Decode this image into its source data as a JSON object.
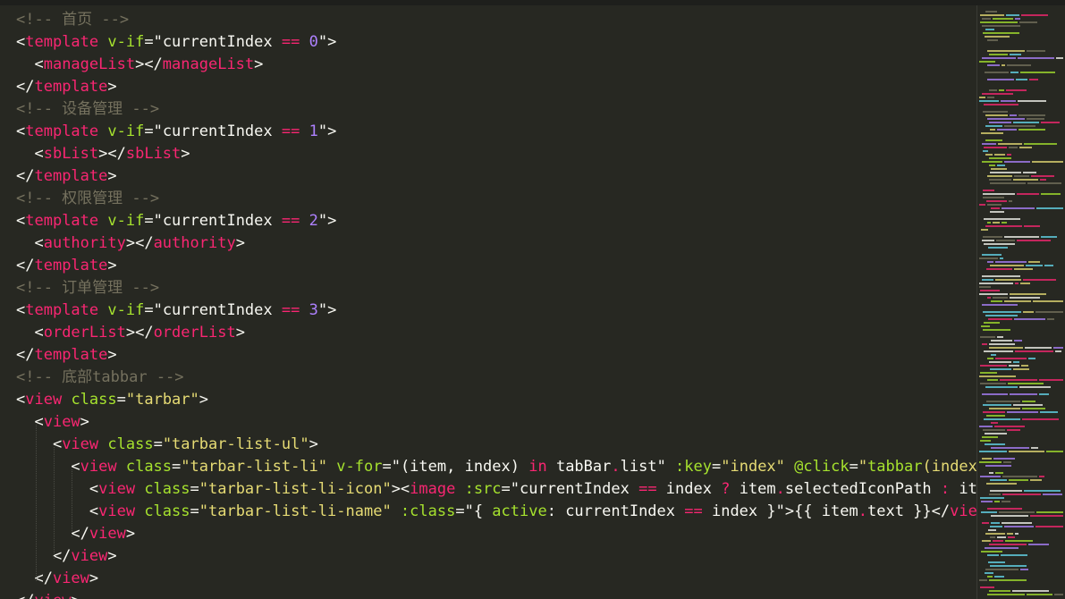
{
  "lines": [
    [
      [
        "c",
        "<!-- 首页 -->"
      ]
    ],
    [
      [
        "p",
        "<"
      ],
      [
        "t",
        "template"
      ],
      [
        "a",
        " v-if"
      ],
      [
        "p",
        "=\""
      ],
      [
        "p",
        "currentIndex "
      ],
      [
        "o",
        "=="
      ],
      [
        "p",
        " "
      ],
      [
        "n",
        "0"
      ],
      [
        "p",
        "\">"
      ]
    ],
    [
      [
        "p",
        "  <"
      ],
      [
        "t",
        "manageList"
      ],
      [
        "p",
        "></"
      ],
      [
        "t",
        "manageList"
      ],
      [
        "p",
        ">"
      ]
    ],
    [
      [
        "p",
        "</"
      ],
      [
        "t",
        "template"
      ],
      [
        "p",
        ">"
      ]
    ],
    [
      [
        "c",
        "<!-- 设备管理 -->"
      ]
    ],
    [
      [
        "p",
        "<"
      ],
      [
        "t",
        "template"
      ],
      [
        "a",
        " v-if"
      ],
      [
        "p",
        "=\""
      ],
      [
        "p",
        "currentIndex "
      ],
      [
        "o",
        "=="
      ],
      [
        "p",
        " "
      ],
      [
        "n",
        "1"
      ],
      [
        "p",
        "\">"
      ]
    ],
    [
      [
        "p",
        "  <"
      ],
      [
        "t",
        "sbList"
      ],
      [
        "p",
        "></"
      ],
      [
        "t",
        "sbList"
      ],
      [
        "p",
        ">"
      ]
    ],
    [
      [
        "p",
        "</"
      ],
      [
        "t",
        "template"
      ],
      [
        "p",
        ">"
      ]
    ],
    [
      [
        "c",
        "<!-- 权限管理 -->"
      ]
    ],
    [
      [
        "p",
        "<"
      ],
      [
        "t",
        "template"
      ],
      [
        "a",
        " v-if"
      ],
      [
        "p",
        "=\""
      ],
      [
        "p",
        "currentIndex "
      ],
      [
        "o",
        "=="
      ],
      [
        "p",
        " "
      ],
      [
        "n",
        "2"
      ],
      [
        "p",
        "\">"
      ]
    ],
    [
      [
        "p",
        "  <"
      ],
      [
        "t",
        "authority"
      ],
      [
        "p",
        "></"
      ],
      [
        "t",
        "authority"
      ],
      [
        "p",
        ">"
      ]
    ],
    [
      [
        "p",
        "</"
      ],
      [
        "t",
        "template"
      ],
      [
        "p",
        ">"
      ]
    ],
    [
      [
        "c",
        "<!-- 订单管理 -->"
      ]
    ],
    [
      [
        "p",
        "<"
      ],
      [
        "t",
        "template"
      ],
      [
        "a",
        " v-if"
      ],
      [
        "p",
        "=\""
      ],
      [
        "p",
        "currentIndex "
      ],
      [
        "o",
        "=="
      ],
      [
        "p",
        " "
      ],
      [
        "n",
        "3"
      ],
      [
        "p",
        "\">"
      ]
    ],
    [
      [
        "p",
        "  <"
      ],
      [
        "t",
        "orderList"
      ],
      [
        "p",
        "></"
      ],
      [
        "t",
        "orderList"
      ],
      [
        "p",
        ">"
      ]
    ],
    [
      [
        "p",
        "</"
      ],
      [
        "t",
        "template"
      ],
      [
        "p",
        ">"
      ]
    ],
    [
      [
        "c",
        "<!-- 底部tabbar -->"
      ]
    ],
    [
      [
        "p",
        "<"
      ],
      [
        "t",
        "view"
      ],
      [
        "a",
        " class"
      ],
      [
        "p",
        "="
      ],
      [
        "s",
        "\"tarbar\""
      ],
      [
        "p",
        ">"
      ]
    ],
    [
      [
        "p",
        "  <"
      ],
      [
        "t",
        "view"
      ],
      [
        "p",
        ">"
      ]
    ],
    [
      [
        "p",
        "    <"
      ],
      [
        "t",
        "view"
      ],
      [
        "a",
        " class"
      ],
      [
        "p",
        "="
      ],
      [
        "s",
        "\"tarbar-list-ul\""
      ],
      [
        "p",
        ">"
      ]
    ],
    [
      [
        "p",
        "      <"
      ],
      [
        "t",
        "view"
      ],
      [
        "a",
        " class"
      ],
      [
        "p",
        "="
      ],
      [
        "s",
        "\"tarbar-list-li\""
      ],
      [
        "a",
        " v-for"
      ],
      [
        "p",
        "=\"(item, index) "
      ],
      [
        "o",
        "in"
      ],
      [
        "p",
        " tabBar"
      ],
      [
        "o",
        "."
      ],
      [
        "p",
        "list\""
      ],
      [
        "a",
        " :key"
      ],
      [
        "p",
        "="
      ],
      [
        "s",
        "\"index\""
      ],
      [
        "a",
        " @click"
      ],
      [
        "p",
        "="
      ],
      [
        "s",
        "\""
      ],
      [
        "a",
        "tabbar"
      ],
      [
        "s",
        "(index)\""
      ],
      [
        "p",
        ">"
      ]
    ],
    [
      [
        "p",
        "        <"
      ],
      [
        "t",
        "view"
      ],
      [
        "a",
        " class"
      ],
      [
        "p",
        "="
      ],
      [
        "s",
        "\"tarbar-list-li-icon\""
      ],
      [
        "p",
        "><"
      ],
      [
        "t",
        "image"
      ],
      [
        "a",
        " :src"
      ],
      [
        "p",
        "=\"currentIndex "
      ],
      [
        "o",
        "=="
      ],
      [
        "p",
        " index "
      ],
      [
        "o",
        "?"
      ],
      [
        "p",
        " item"
      ],
      [
        "o",
        "."
      ],
      [
        "p",
        "selectedIconPath "
      ],
      [
        "o",
        ":"
      ],
      [
        "p",
        " item"
      ],
      [
        "o",
        "."
      ],
      [
        "p",
        "iconPath\""
      ],
      [
        "p",
        "></"
      ],
      [
        "t",
        "image"
      ],
      [
        "p",
        "></"
      ],
      [
        "t",
        "view"
      ],
      [
        "p",
        ">"
      ]
    ],
    [
      [
        "p",
        "        <"
      ],
      [
        "t",
        "view"
      ],
      [
        "a",
        " class"
      ],
      [
        "p",
        "="
      ],
      [
        "s",
        "\"tarbar-list-li-name\""
      ],
      [
        "a",
        " :class"
      ],
      [
        "p",
        "=\"{ "
      ],
      [
        "a",
        "active"
      ],
      [
        "p",
        ": currentIndex "
      ],
      [
        "o",
        "=="
      ],
      [
        "p",
        " index }\">{{ item"
      ],
      [
        "o",
        "."
      ],
      [
        "p",
        "text }}</"
      ],
      [
        "t",
        "view"
      ],
      [
        "p",
        ">"
      ]
    ],
    [
      [
        "p",
        "      </"
      ],
      [
        "t",
        "view"
      ],
      [
        "p",
        ">"
      ]
    ],
    [
      [
        "p",
        "    </"
      ],
      [
        "t",
        "view"
      ],
      [
        "p",
        ">"
      ]
    ],
    [
      [
        "p",
        "  </"
      ],
      [
        "t",
        "view"
      ],
      [
        "p",
        ">"
      ]
    ],
    [
      [
        "p",
        "</"
      ],
      [
        "t",
        "view"
      ],
      [
        "p",
        ">"
      ]
    ]
  ],
  "colors": {
    "background": "#272822",
    "comment": "#75715e",
    "tag": "#f92672",
    "attribute": "#a6e22e",
    "string": "#e6db74",
    "number": "#ae81ff",
    "text": "#f8f8f2"
  }
}
